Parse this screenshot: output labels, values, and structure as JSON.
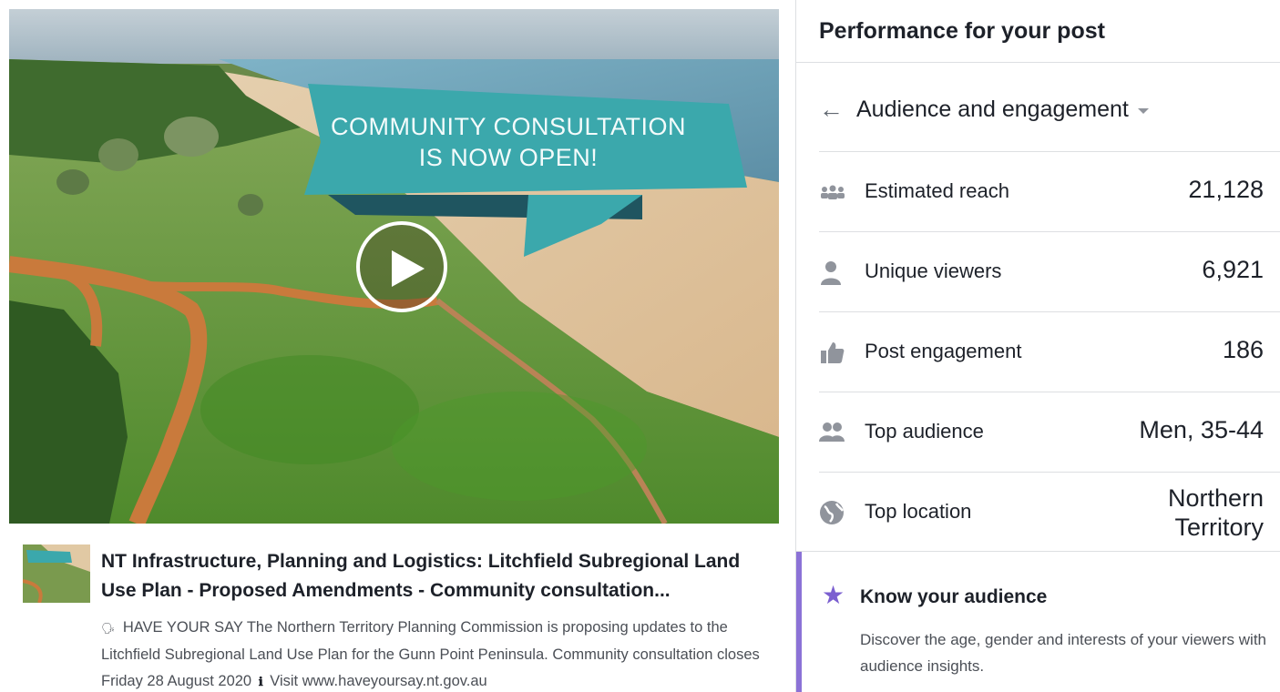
{
  "video": {
    "banner_line1": "COMMUNITY CONSULTATION",
    "banner_line2": "IS NOW OPEN!",
    "play_icon": "play-icon"
  },
  "link": {
    "title": "NT Infrastructure, Planning and Logistics: Litchfield Subregional Land Use Plan - Proposed Amendments - Community consultation...",
    "desc_part1": "HAVE YOUR SAY The Northern Territory Planning Commission is proposing updates to the Litchfield Subregional Land Use Plan for the Gunn Point Peninsula. Community consultation closes Friday 28 August 2020",
    "desc_part2": "Visit www.haveyoursay.nt.gov.au",
    "bullet_glyph": "🗣",
    "info_glyph": "ℹ"
  },
  "panel": {
    "title": "Performance for your post",
    "selector_label": "Audience and engagement",
    "metrics": [
      {
        "icon": "people-group-icon",
        "label": "Estimated reach",
        "value": "21,128"
      },
      {
        "icon": "person-icon",
        "label": "Unique viewers",
        "value": "6,921"
      },
      {
        "icon": "thumbs-up-icon",
        "label": "Post engagement",
        "value": "186"
      },
      {
        "icon": "two-people-icon",
        "label": "Top audience",
        "value": "Men, 35-44"
      },
      {
        "icon": "globe-icon",
        "label": "Top location",
        "value_line1": "Northern",
        "value_line2": "Territory"
      }
    ],
    "tip": {
      "icon": "star-icon",
      "title": "Know your audience",
      "body": "Discover the age, gender and interests of your viewers with audience insights."
    }
  },
  "colors": {
    "accent_teal": "#3aa6a9",
    "tip_accent": "#8b72d6",
    "text_primary": "#1d2129",
    "text_secondary": "#4b4f56"
  }
}
